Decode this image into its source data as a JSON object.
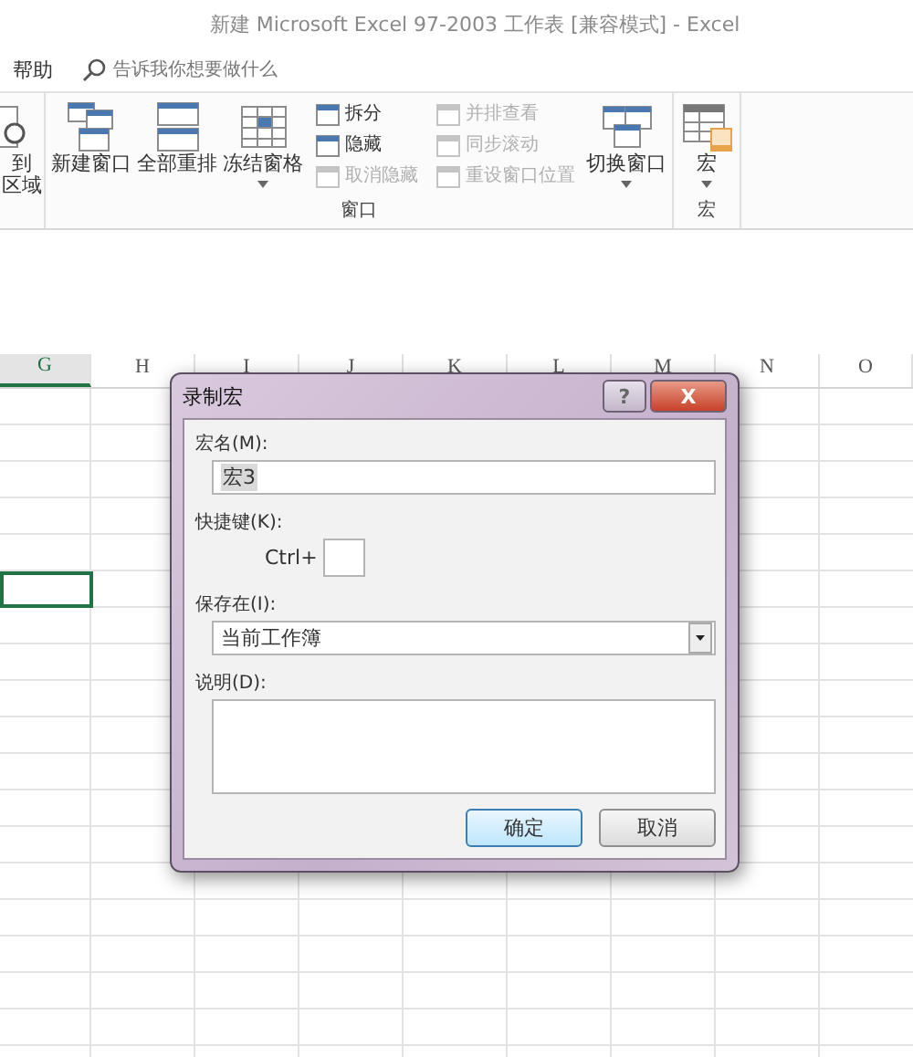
{
  "window": {
    "title": "新建 Microsoft Excel 97-2003 工作表  [兼容模式]  -  Excel"
  },
  "menu": {
    "items": [
      {
        "label": "帮助"
      }
    ],
    "search": {
      "placeholder": "告诉我你想要做什么"
    }
  },
  "ribbon": {
    "groups": [
      {
        "items": [
          {
            "kind": "large",
            "label_lines": [
              "到",
              "区域"
            ],
            "dropdown": false,
            "disabled": false
          }
        ]
      },
      {
        "label": "窗口",
        "items": [
          {
            "kind": "large",
            "label_lines": [
              "新建窗口"
            ],
            "dropdown": false,
            "disabled": false
          },
          {
            "kind": "large",
            "label_lines": [
              "全部重排"
            ],
            "dropdown": false,
            "disabled": false
          },
          {
            "kind": "large",
            "label_lines": [
              "冻结窗格"
            ],
            "dropdown": true,
            "disabled": false
          },
          {
            "kind": "stack",
            "buttons": [
              {
                "label": "拆分",
                "disabled": false
              },
              {
                "label": "隐藏",
                "disabled": false
              },
              {
                "label": "取消隐藏",
                "disabled": true
              }
            ]
          },
          {
            "kind": "stack",
            "buttons": [
              {
                "label": "并排查看",
                "disabled": true
              },
              {
                "label": "同步滚动",
                "disabled": true
              },
              {
                "label": "重设窗口位置",
                "disabled": true
              }
            ]
          },
          {
            "kind": "large",
            "label_lines": [
              "切换窗口"
            ],
            "dropdown": true,
            "disabled": false
          }
        ]
      },
      {
        "label": "宏",
        "items": [
          {
            "kind": "large",
            "label_lines": [
              "宏"
            ],
            "dropdown": true,
            "disabled": false
          }
        ]
      }
    ]
  },
  "sheet": {
    "columns": [
      {
        "label": "G",
        "selected": true
      },
      {
        "label": "H",
        "selected": false
      },
      {
        "label": "I",
        "selected": false
      },
      {
        "label": "J",
        "selected": false
      },
      {
        "label": "K",
        "selected": false
      },
      {
        "label": "L",
        "selected": false
      },
      {
        "label": "M",
        "selected": false
      },
      {
        "label": "N",
        "selected": false
      },
      {
        "label": "O",
        "selected": false
      }
    ]
  },
  "dialog": {
    "title": "录制宏",
    "help": "?",
    "close": "X",
    "fields": [
      {
        "kind": "text",
        "label": "宏名(M):",
        "value": "宏3",
        "highlighted": true
      },
      {
        "kind": "shortcut",
        "label": "快捷键(K):",
        "prefix": "Ctrl+"
      },
      {
        "kind": "select",
        "label": "保存在(I):",
        "value": "当前工作簿"
      },
      {
        "kind": "textarea",
        "label": "说明(D):"
      }
    ],
    "buttons": [
      {
        "label": "确定",
        "default": true
      },
      {
        "label": "取消",
        "default": false
      }
    ]
  }
}
